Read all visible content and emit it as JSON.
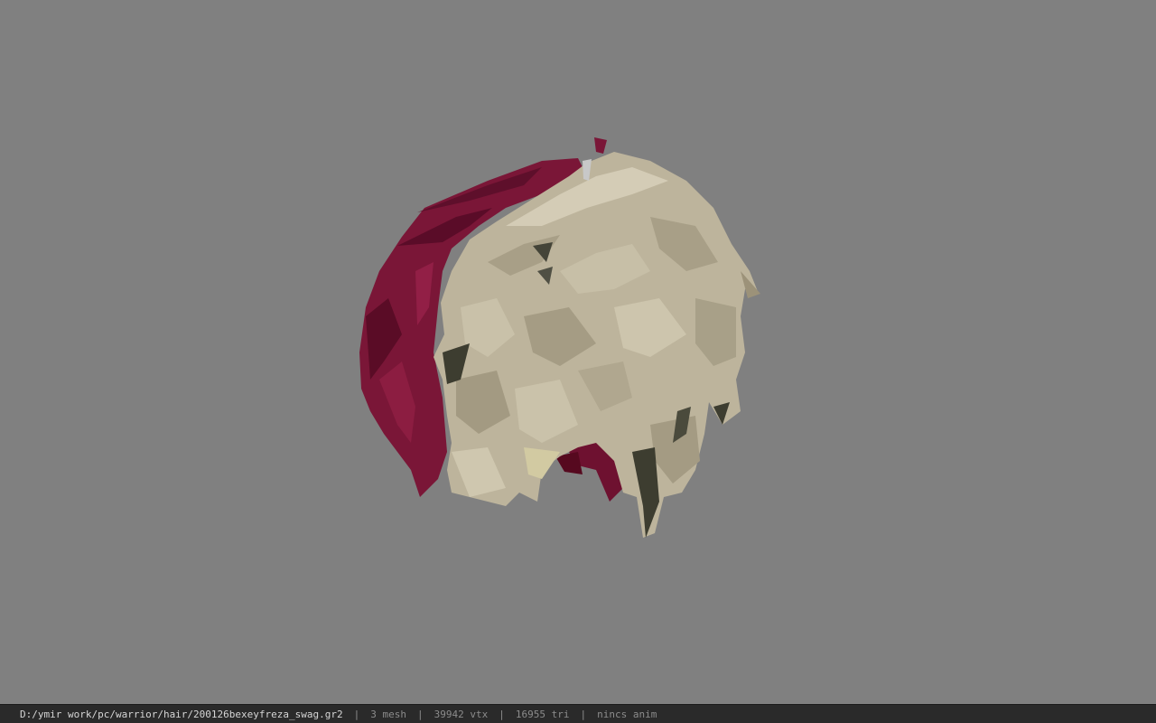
{
  "viewer": {
    "background_color": "#808080",
    "model_colors": {
      "blonde": "#bdb49c",
      "blonde_shade": "#9c9279",
      "blonde_light": "#d4ccb6",
      "crimson": "#7a1637",
      "crimson_dark": "#4f0a22",
      "skin": "#b9763a",
      "dark_strand": "#3d3d30"
    }
  },
  "status_bar": {
    "file_path": "D:/ymir work/pc/warrior/hair/200126bexeyfreza_swag.gr2",
    "separator": "|",
    "mesh_count": "3 mesh",
    "vertex_count": "39942 vtx",
    "triangle_count": "16955 tri",
    "anim_status": "nincs anim"
  }
}
